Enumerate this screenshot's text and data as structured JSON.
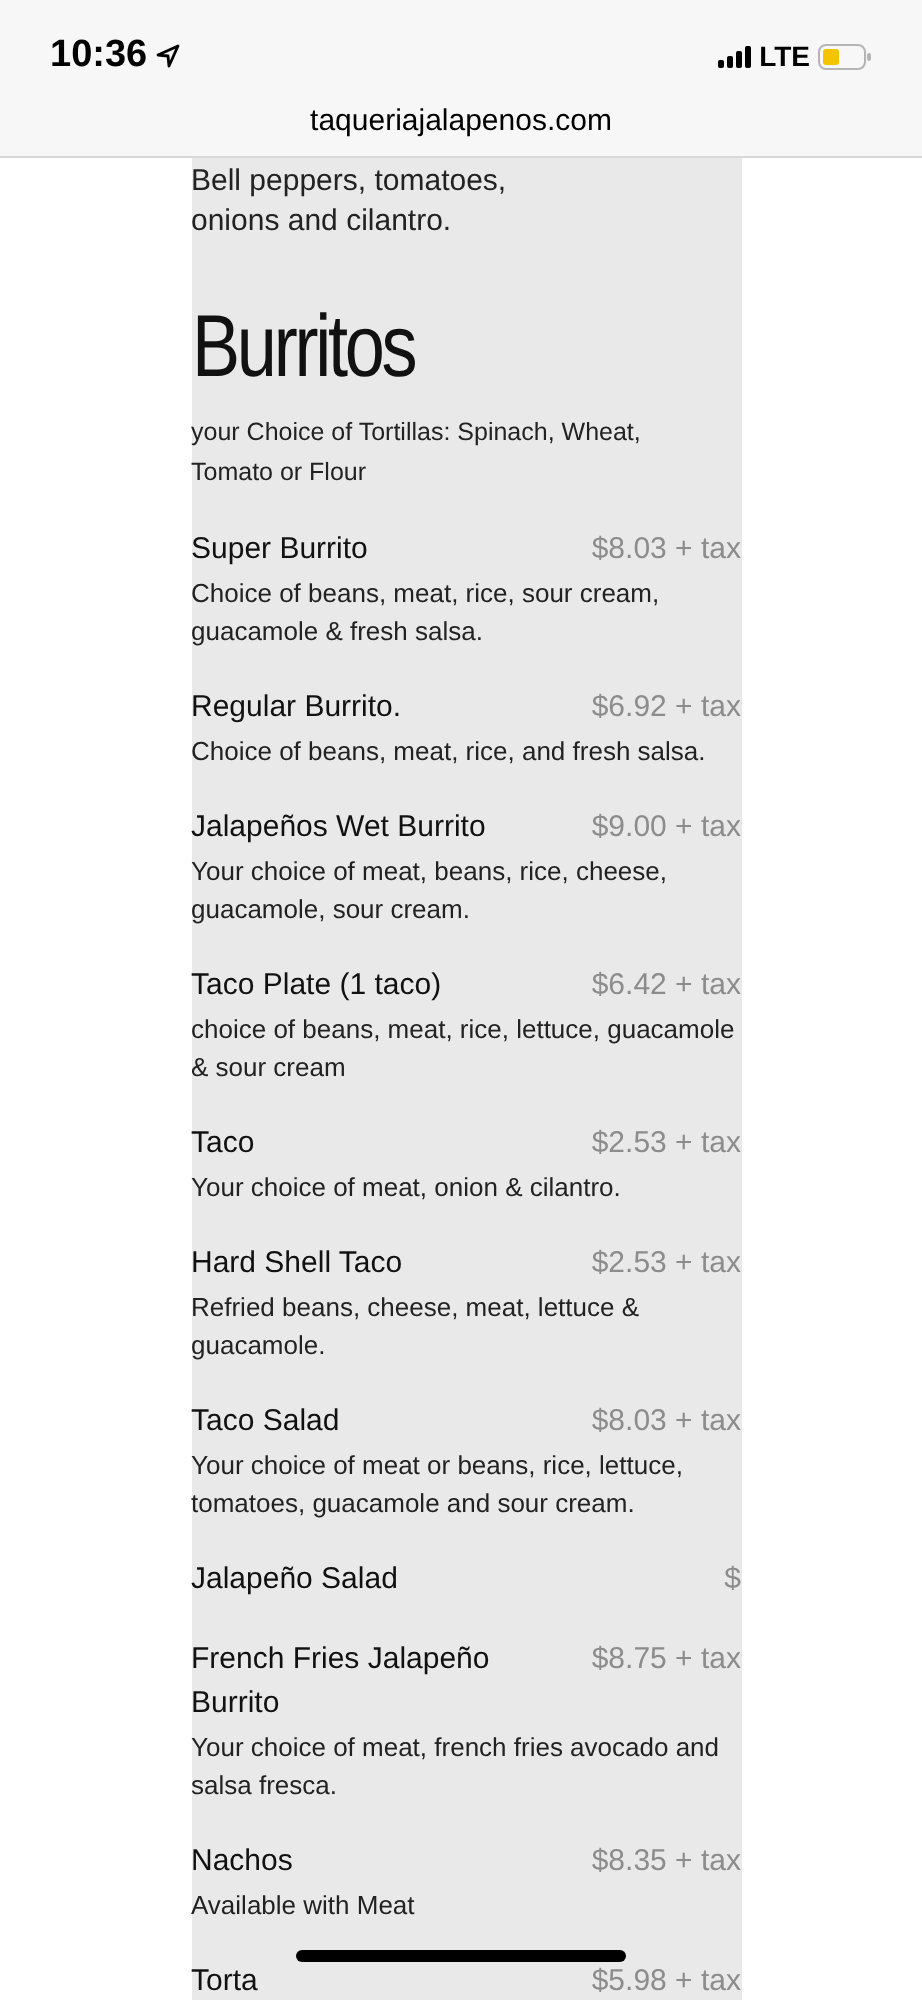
{
  "status_bar": {
    "time": "10:36",
    "network": "LTE"
  },
  "url_bar": {
    "url": "taqueriajalapenos.com"
  },
  "intro_text": "Bell peppers, tomatoes, onions and cilantro.",
  "section": {
    "title": "Burritos",
    "subtitle": "your Choice of Tortillas: Spinach, Wheat, Tomato or Flour"
  },
  "items": [
    {
      "name": "Super Burrito",
      "price": "$8.03 + tax",
      "description": "Choice of beans, meat, rice, sour cream, guacamole & fresh salsa."
    },
    {
      "name": "Regular Burrito.",
      "price": "$6.92 + tax",
      "description": "Choice of beans, meat, rice, and fresh salsa."
    },
    {
      "name": "Jalapeños Wet Burrito",
      "price": "$9.00 + tax",
      "description": "Your choice of meat, beans, rice, cheese, guacamole, sour cream."
    },
    {
      "name": "Taco Plate (1 taco)",
      "price": "$6.42 + tax",
      "description": "choice of beans, meat, rice, lettuce, guacamole & sour cream"
    },
    {
      "name": "Taco",
      "price": "$2.53 + tax",
      "description": "Your choice of meat, onion & cilantro."
    },
    {
      "name": "Hard Shell Taco",
      "price": "$2.53 + tax",
      "description": "Refried beans, cheese, meat, lettuce & guacamole."
    },
    {
      "name": "Taco Salad",
      "price": "$8.03 + tax",
      "description": "Your choice of meat or beans, rice, lettuce, tomatoes, guacamole and sour cream."
    },
    {
      "name": "Jalapeño Salad",
      "price": "$"
    },
    {
      "name": "French Fries Jalapeño Burrito",
      "price": "$8.75 + tax",
      "description": "Your choice of meat, french fries avocado and salsa fresca."
    },
    {
      "name": "Nachos",
      "price": "$8.35 + tax",
      "description": "Available with Meat"
    },
    {
      "name": "Torta",
      "price": "$5.98 + tax"
    }
  ]
}
